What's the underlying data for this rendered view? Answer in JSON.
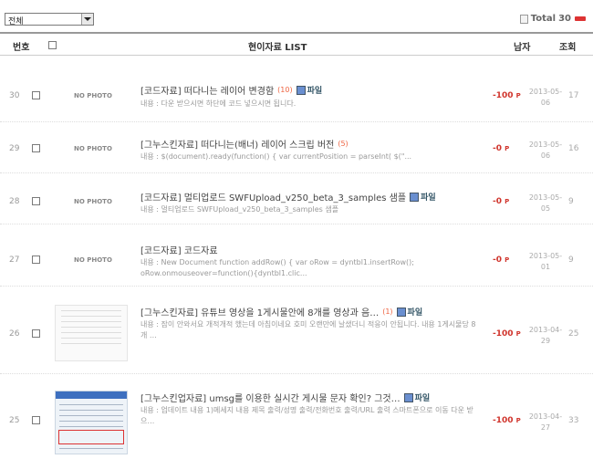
{
  "filter": {
    "selected": "전체"
  },
  "summary": {
    "label": "Total",
    "count": "30"
  },
  "table": {
    "headers": {
      "no": "번호",
      "title": "현이자료 LIST",
      "points": "남자",
      "hits": "조회"
    },
    "rows": [
      {
        "no": "30",
        "photo": "NO PHOTO",
        "title": "[코드자료] 떠다니는 레이어 변경함",
        "comments": "(10)",
        "file": "파일",
        "body": "내용 : 다운 받으시면 하단에 코드 넣으시면 됩니다.",
        "points": "-100",
        "unit": "P",
        "date1": "2013-05-",
        "date2": "06",
        "hits": "17"
      },
      {
        "no": "29",
        "photo": "NO PHOTO",
        "title": "[그누스킨자료] 떠다니는(배너) 레이어 스크립 버전",
        "comments": "(5)",
        "file": "",
        "body": "내용 : $(document).ready(function() { var currentPosition = parseInt( $(\"...",
        "points": "-0",
        "unit": "P",
        "date1": "2013-05-",
        "date2": "06",
        "hits": "16"
      },
      {
        "no": "28",
        "photo": "NO PHOTO",
        "title": "[코드자료] 멀티업로드 SWFUpload_v250_beta_3_samples 샘플",
        "comments": "",
        "file": "파일",
        "body": "내용 : 멀티업로드 SWFUpload_v250_beta_3_samples 샘플",
        "points": "-0",
        "unit": "P",
        "date1": "2013-05-",
        "date2": "05",
        "hits": "9"
      },
      {
        "no": "27",
        "photo": "NO PHOTO",
        "title": "[코드자료] 코드자료",
        "comments": "",
        "file": "",
        "body": "내용 : New Document function addRow() { var oRow = dyntbl1.insertRow(); oRow.onmouseover=function(){dyntbl1.clic...",
        "points": "-0",
        "unit": "P",
        "date1": "2013-05-",
        "date2": "01",
        "hits": "9"
      },
      {
        "no": "26",
        "photo": "",
        "title": "[그누스킨자료] 유튜브 영상을 1게시물안에 8개를 영상과 음…",
        "comments": "(1)",
        "file": "파일",
        "body": "내용 : 잠이 안와서요 개적개적 했는데 아침이네요 호미 오랜만에 날샜더니 적응이 안됩니다. 내용 1게시물당 8개 …",
        "points": "-100",
        "unit": "P",
        "date1": "2013-04-",
        "date2": "29",
        "hits": "25"
      },
      {
        "no": "25",
        "photo": "",
        "title": "[그누스킨업자료] umsg를 이용한 실시간 게시물 문자 확인? 그것…",
        "comments": "",
        "file": "파일",
        "body": "내용 : 업데이트 내용 1)메세지 내용 제목 출력/성명 출력/전화번호 출력/URL 출력 스마트폰으로 이동 다운 받으…",
        "points": "-100",
        "unit": "P",
        "date1": "2013-04-",
        "date2": "27",
        "hits": "33"
      }
    ]
  }
}
